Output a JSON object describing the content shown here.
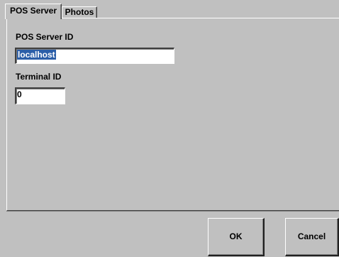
{
  "tabs": [
    {
      "label": "POS Server",
      "active": true
    },
    {
      "label": "Photos",
      "active": false
    }
  ],
  "form": {
    "server_id_label": "POS Server ID",
    "server_id_value": "localhost",
    "terminal_id_label": "Terminal ID",
    "terminal_id_value": "0"
  },
  "buttons": {
    "ok_label": "OK",
    "cancel_label": "Cancel"
  },
  "colors": {
    "background": "#c0c0c0",
    "selection": "#2b5ea8"
  }
}
